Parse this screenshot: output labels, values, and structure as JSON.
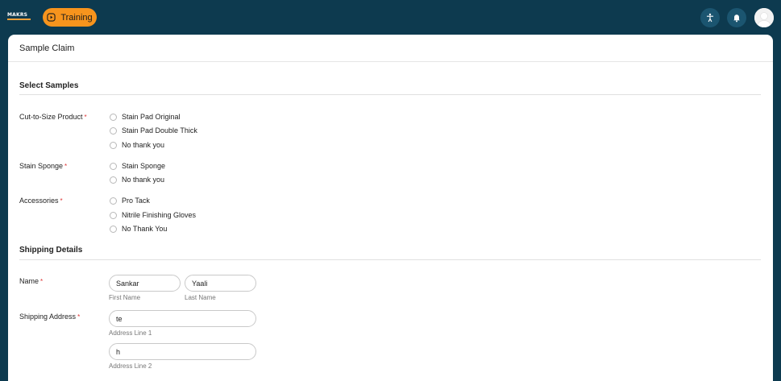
{
  "topbar": {
    "logo_text": "MAKRS",
    "training_label": "Training",
    "icons": [
      "accessibility-icon",
      "bell-icon",
      "user-avatar-icon"
    ]
  },
  "card": {
    "title": "Sample Claim"
  },
  "select_samples": {
    "title": "Select Samples",
    "cut_to_size": {
      "label": "Cut-to-Size Product",
      "required_mark": "*",
      "options": [
        "Stain Pad Original",
        "Stain Pad Double Thick",
        "No thank you"
      ]
    },
    "stain_sponge": {
      "label": "Stain Sponge",
      "required_mark": "*",
      "options": [
        "Stain Sponge",
        "No thank you"
      ]
    },
    "accessories": {
      "label": "Accessories",
      "required_mark": "*",
      "options": [
        "Pro Tack",
        "Nitrile Finishing Gloves",
        "No Thank You"
      ]
    }
  },
  "shipping": {
    "title": "Shipping Details",
    "name": {
      "label": "Name",
      "required_mark": "*",
      "first_value": "Sankar",
      "first_hint": "First Name",
      "last_value": "Yaali",
      "last_hint": "Last Name"
    },
    "address": {
      "label": "Shipping Address",
      "required_mark": "*",
      "line1_value": "te",
      "line1_hint": "Address Line 1",
      "line2_value": "h",
      "line2_hint": "Address Line 2"
    }
  },
  "colors": {
    "topbar_bg": "#0d3a4f",
    "accent_orange": "#f7941d",
    "required_red": "#d33333"
  }
}
